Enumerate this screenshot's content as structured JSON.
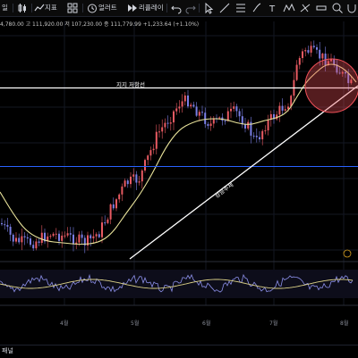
{
  "toolbar": {
    "interval_label": "일",
    "indicator_label": "지표",
    "alert_label": "얼러트",
    "replay_label": "리플레이",
    "undo_icon": "undo-icon",
    "redo_icon": "redo-icon"
  },
  "legend": {
    "ohlc_text": "4,780.00  고 111,920.00  저 107,230.00  종 111,779.99  +1,233.64 (+1.10%)"
  },
  "chart": {
    "resistance_label": "지지 저항선",
    "trend_label": "상승추세",
    "time_labels": [
      "4월",
      "5월",
      "6월",
      "7월",
      "8월"
    ],
    "colors": {
      "up": "#e85a62",
      "down": "#7a7fe6",
      "ma": "#e8e29a",
      "resistance": "#ffffff",
      "support_blue": "#2962ff",
      "circle_fill": "#f05058",
      "oscillator": "#8b8fe8",
      "oscillator_signal": "#d9cf86"
    }
  },
  "bottom_panel": {
    "label": "패널"
  }
}
